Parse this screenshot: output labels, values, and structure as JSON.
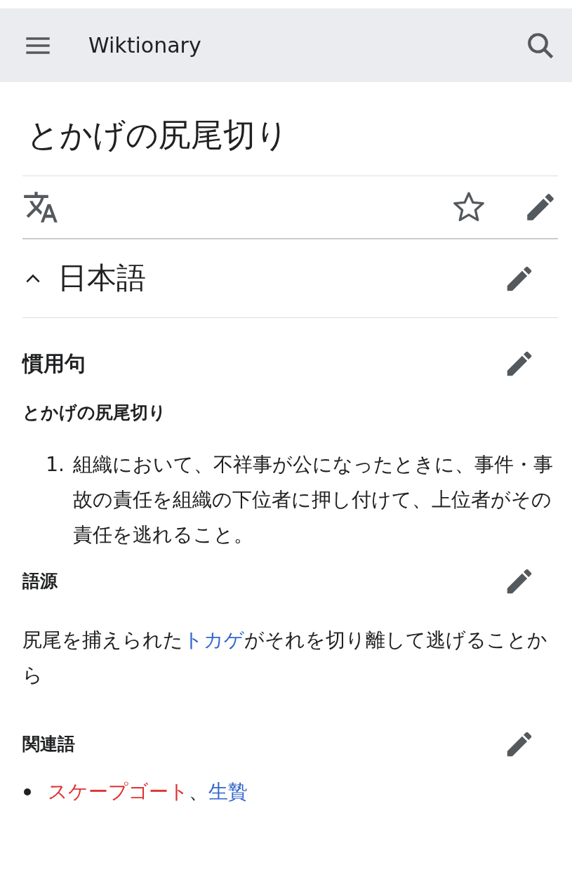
{
  "header": {
    "title": "Wiktionary"
  },
  "page_title": "とかげの尻尾切り",
  "language_section": {
    "title": "日本語",
    "expanded": true
  },
  "idiom": {
    "heading": "慣用句",
    "headword": "とかげの尻尾切り",
    "definitions": [
      {
        "number": "1.",
        "text": "組織において、不祥事が公になったときに、事件・事故の責任を組織の下位者に押し付けて、上位者がその責任を逃れること。"
      }
    ]
  },
  "etymology": {
    "heading": "語源",
    "segments": [
      {
        "kind": "text",
        "text": "尻尾を捕えられた"
      },
      {
        "kind": "link",
        "text": "トカゲ",
        "exists": true
      },
      {
        "kind": "text",
        "text": "がそれを切り離して逃げることから"
      }
    ]
  },
  "related": {
    "heading": "関連語",
    "items": [
      {
        "parts": [
          {
            "kind": "link",
            "text": "スケープゴート",
            "exists": false
          },
          {
            "kind": "text",
            "text": "、"
          },
          {
            "kind": "link",
            "text": "生贄",
            "exists": true
          }
        ]
      }
    ]
  }
}
